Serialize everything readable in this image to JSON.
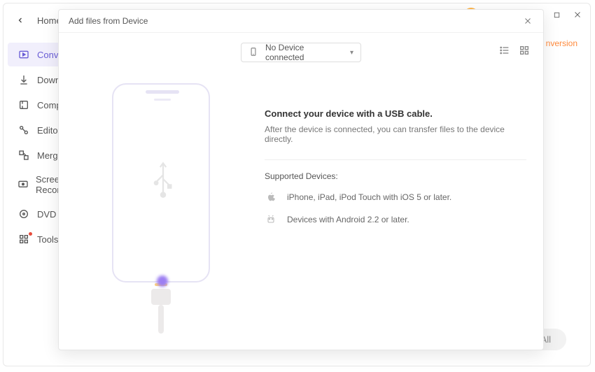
{
  "window": {
    "avatar_initial": ""
  },
  "sidebar": {
    "back_label": "Home",
    "items": [
      {
        "label": "Converter"
      },
      {
        "label": "Downloader"
      },
      {
        "label": "Compressor"
      },
      {
        "label": "Editor"
      },
      {
        "label": "Merger"
      },
      {
        "label": "Screen Recorder"
      },
      {
        "label": "DVD Burner"
      },
      {
        "label": "Tools"
      }
    ]
  },
  "right": {
    "tag": "nversion",
    "all_btn": "All"
  },
  "modal": {
    "title": "Add files from Device",
    "device_select": {
      "label": "No Device connected"
    },
    "headline": "Connect your device with a USB cable.",
    "subline": "After the device is connected, you can transfer files to the device directly.",
    "supported_label": "Supported Devices:",
    "devices": [
      {
        "text": "iPhone, iPad, iPod Touch with iOS 5 or later."
      },
      {
        "text": "Devices with Android 2.2 or later."
      }
    ]
  }
}
